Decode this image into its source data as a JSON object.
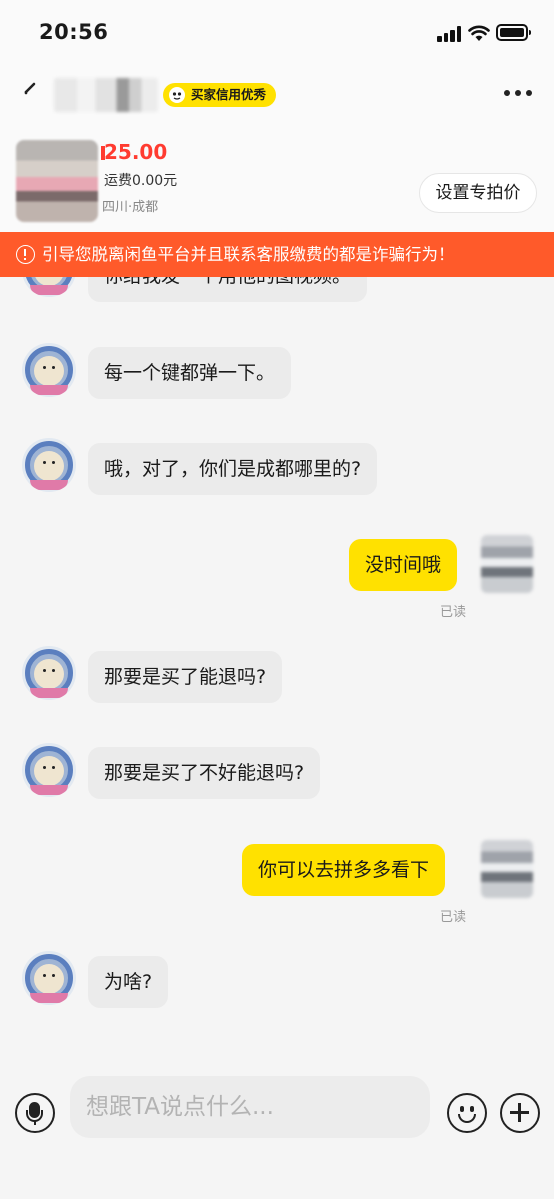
{
  "status_bar": {
    "time": "20:56"
  },
  "nav": {
    "credit_badge": "买家信用优秀"
  },
  "product": {
    "price": "25.00",
    "shipping": "运费0.00元",
    "location": "四川·成都",
    "set_price_label": "设置专拍价"
  },
  "warning": {
    "text": "引导您脱离闲鱼平台并且联系客服缴费的都是诈骗行为！"
  },
  "messages": [
    {
      "side": "left",
      "text": "你给我发一个用他的图视频。"
    },
    {
      "side": "left",
      "text": "每一个键都弹一下。"
    },
    {
      "side": "left",
      "text": "哦，对了，你们是成都哪里的?"
    },
    {
      "side": "right",
      "text": "没时间哦",
      "status": "已读"
    },
    {
      "side": "left",
      "text": "那要是买了能退吗?"
    },
    {
      "side": "left",
      "text": "那要是买了不好能退吗?"
    },
    {
      "side": "right",
      "text": "你可以去拼多多看下",
      "status": "已读"
    },
    {
      "side": "left",
      "text": "为啥?"
    }
  ],
  "input_bar": {
    "placeholder": "想跟TA说点什么..."
  }
}
